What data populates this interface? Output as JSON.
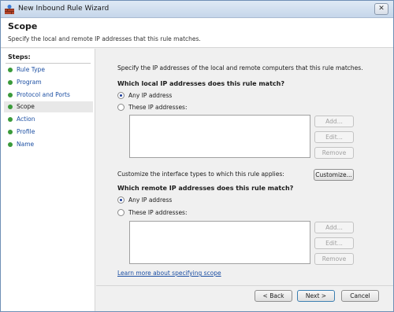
{
  "window": {
    "title": "New Inbound Rule Wizard",
    "close_glyph": "✕"
  },
  "header": {
    "title": "Scope",
    "subtitle": "Specify the local and remote IP addresses that this rule matches."
  },
  "steps": {
    "title": "Steps:",
    "items": [
      {
        "label": "Rule Type"
      },
      {
        "label": "Program"
      },
      {
        "label": "Protocol and Ports"
      },
      {
        "label": "Scope"
      },
      {
        "label": "Action"
      },
      {
        "label": "Profile"
      },
      {
        "label": "Name"
      }
    ],
    "current": "Scope"
  },
  "content": {
    "intro": "Specify the IP addresses of the local and remote computers that this rule matches.",
    "local": {
      "heading": "Which local IP addresses does this rule match?",
      "any_label": "Any IP address",
      "these_label": "These IP addresses:",
      "selected": "any",
      "add": "Add...",
      "edit": "Edit...",
      "remove": "Remove"
    },
    "customize_text": "Customize the interface types to which this rule applies:",
    "customize_button": "Customize...",
    "remote": {
      "heading": "Which remote IP addresses does this rule match?",
      "any_label": "Any IP address",
      "these_label": "These IP addresses:",
      "selected": "any",
      "add": "Add...",
      "edit": "Edit...",
      "remove": "Remove"
    },
    "learn_more": "Learn more about specifying scope"
  },
  "footer": {
    "back": "< Back",
    "next": "Next >",
    "cancel": "Cancel"
  }
}
